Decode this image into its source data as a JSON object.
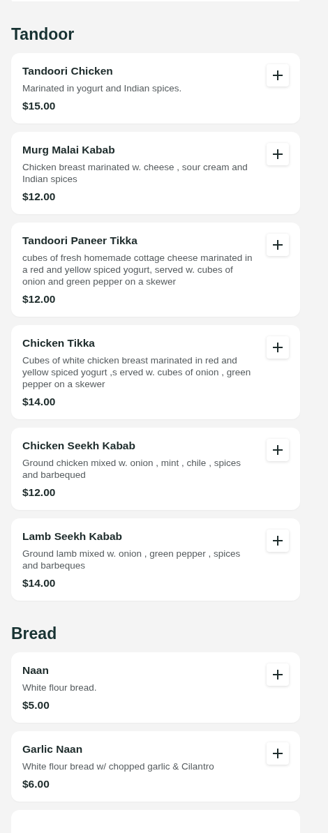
{
  "sections": [
    {
      "title": "Tandoor",
      "items": [
        {
          "name": "Tandoori Chicken",
          "description": "Marinated in yogurt and Indian spices.",
          "price": "$15.00"
        },
        {
          "name": "Murg Malai Kabab",
          "description": "Chicken breast marinated w. cheese , sour cream and Indian spices",
          "price": "$12.00"
        },
        {
          "name": "Tandoori Paneer Tikka",
          "description": "cubes of fresh homemade cottage cheese marinated in a red and yellow spiced yogurt, served w. cubes of onion and green pepper on a skewer",
          "price": "$12.00"
        },
        {
          "name": "Chicken Tikka",
          "description": "Cubes of white chicken breast marinated in red and yellow spiced yogurt ,s erved w. cubes of onion , green pepper on a skewer",
          "price": "$14.00"
        },
        {
          "name": "Chicken Seekh Kabab",
          "description": "Ground chicken mixed w. onion , mint , chile , spices and barbequed",
          "price": "$12.00"
        },
        {
          "name": "Lamb Seekh Kabab",
          "description": "Ground lamb mixed w. onion , green pepper , spices and barbeques",
          "price": "$14.00"
        }
      ]
    },
    {
      "title": "Bread",
      "items": [
        {
          "name": "Naan",
          "description": "White flour bread.",
          "price": "$5.00"
        },
        {
          "name": "Garlic Naan",
          "description": "White flour bread w/ chopped garlic & Cilantro",
          "price": "$6.00"
        }
      ]
    }
  ]
}
